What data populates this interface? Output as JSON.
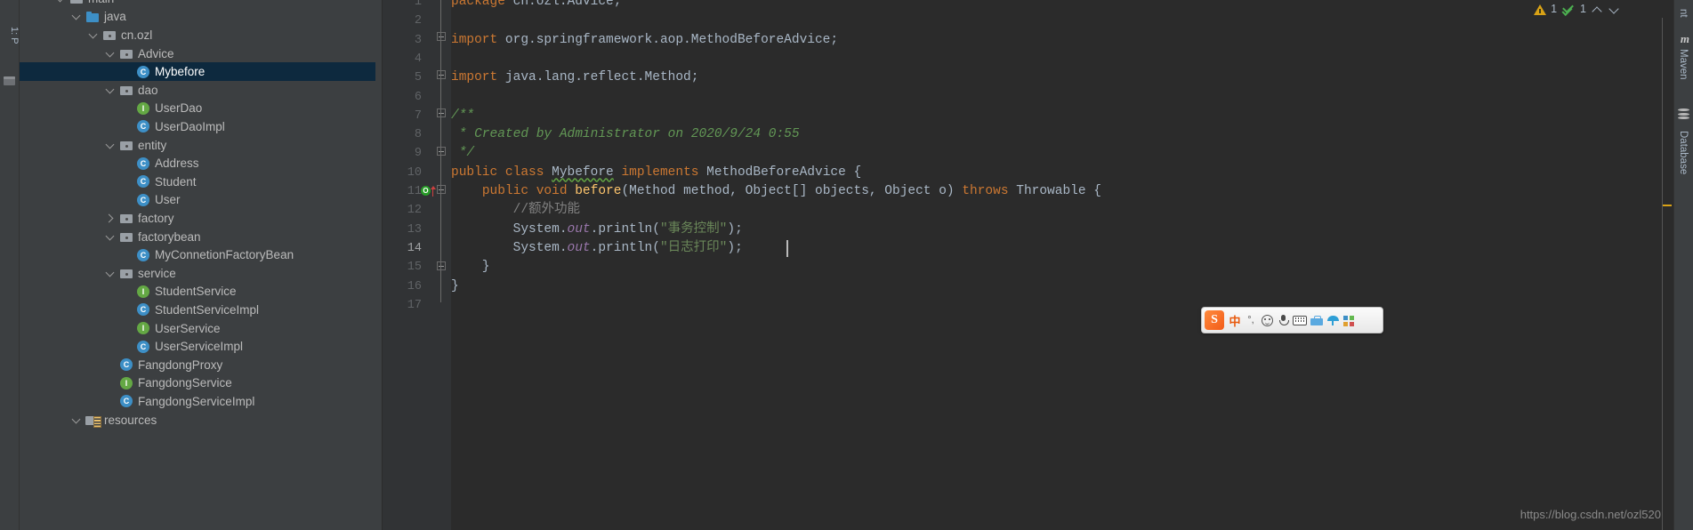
{
  "left_tool_strip": {
    "project_tab": "1: P",
    "structure_icon": "structure-icon"
  },
  "project_tree": {
    "rows": [
      {
        "label": "main",
        "indent": 40,
        "twisty": "open",
        "icon": "folder-plain",
        "selected": false
      },
      {
        "label": "java",
        "indent": 58,
        "twisty": "open",
        "icon": "folder-src",
        "selected": false
      },
      {
        "label": "cn.ozl",
        "indent": 77,
        "twisty": "open",
        "icon": "folder-pkg",
        "selected": false
      },
      {
        "label": "Advice",
        "indent": 96,
        "twisty": "open",
        "icon": "folder-pkg",
        "selected": false
      },
      {
        "label": "Mybefore",
        "indent": 115,
        "twisty": "none",
        "icon": "cls",
        "selected": true
      },
      {
        "label": "dao",
        "indent": 96,
        "twisty": "open",
        "icon": "folder-pkg",
        "selected": false
      },
      {
        "label": "UserDao",
        "indent": 115,
        "twisty": "none",
        "icon": "iface",
        "selected": false
      },
      {
        "label": "UserDaoImpl",
        "indent": 115,
        "twisty": "none",
        "icon": "cls",
        "selected": false
      },
      {
        "label": "entity",
        "indent": 96,
        "twisty": "open",
        "icon": "folder-pkg",
        "selected": false
      },
      {
        "label": "Address",
        "indent": 115,
        "twisty": "none",
        "icon": "cls",
        "selected": false
      },
      {
        "label": "Student",
        "indent": 115,
        "twisty": "none",
        "icon": "cls",
        "selected": false
      },
      {
        "label": "User",
        "indent": 115,
        "twisty": "none",
        "icon": "cls",
        "selected": false
      },
      {
        "label": "factory",
        "indent": 96,
        "twisty": "closed",
        "icon": "folder-pkg",
        "selected": false
      },
      {
        "label": "factorybean",
        "indent": 96,
        "twisty": "open",
        "icon": "folder-pkg",
        "selected": false
      },
      {
        "label": "MyConnetionFactoryBean",
        "indent": 115,
        "twisty": "none",
        "icon": "cls",
        "selected": false
      },
      {
        "label": "service",
        "indent": 96,
        "twisty": "open",
        "icon": "folder-pkg",
        "selected": false
      },
      {
        "label": "StudentService",
        "indent": 115,
        "twisty": "none",
        "icon": "iface",
        "selected": false
      },
      {
        "label": "StudentServiceImpl",
        "indent": 115,
        "twisty": "none",
        "icon": "cls",
        "selected": false
      },
      {
        "label": "UserService",
        "indent": 115,
        "twisty": "none",
        "icon": "iface",
        "selected": false
      },
      {
        "label": "UserServiceImpl",
        "indent": 115,
        "twisty": "none",
        "icon": "cls",
        "selected": false
      },
      {
        "label": "FangdongProxy",
        "indent": 96,
        "twisty": "none",
        "icon": "cls",
        "selected": false
      },
      {
        "label": "FangdongService",
        "indent": 96,
        "twisty": "none",
        "icon": "iface",
        "selected": false
      },
      {
        "label": "FangdongServiceImpl",
        "indent": 96,
        "twisty": "none",
        "icon": "cls",
        "selected": false
      },
      {
        "label": "resources",
        "indent": 58,
        "twisty": "open",
        "icon": "folder-res",
        "selected": false
      }
    ]
  },
  "editor": {
    "line_numbers": [
      "1",
      "2",
      "3",
      "4",
      "5",
      "6",
      "7",
      "8",
      "9",
      "10",
      "11",
      "12",
      "13",
      "14",
      "15",
      "16",
      "17"
    ],
    "current_line": "14",
    "lines": [
      {
        "n": "1",
        "tokens": [
          {
            "t": "package ",
            "c": "kw"
          },
          {
            "t": "cn.ozl.Advice;",
            "c": "txt"
          }
        ]
      },
      {
        "n": "2",
        "tokens": []
      },
      {
        "n": "3",
        "tokens": [
          {
            "t": "import ",
            "c": "kw"
          },
          {
            "t": "org.springframework.aop.MethodBeforeAdvice;",
            "c": "txt"
          }
        ]
      },
      {
        "n": "4",
        "tokens": []
      },
      {
        "n": "5",
        "tokens": [
          {
            "t": "import ",
            "c": "kw"
          },
          {
            "t": "java.lang.reflect.Method;",
            "c": "txt"
          }
        ]
      },
      {
        "n": "6",
        "tokens": []
      },
      {
        "n": "7",
        "tokens": [
          {
            "t": "/**",
            "c": "doc"
          }
        ]
      },
      {
        "n": "8",
        "tokens": [
          {
            "t": " * Created by Administrator on 2020/9/24 0:55",
            "c": "doc"
          }
        ]
      },
      {
        "n": "9",
        "tokens": [
          {
            "t": " */",
            "c": "doc"
          }
        ]
      },
      {
        "n": "10",
        "tokens": [
          {
            "t": "public class ",
            "c": "kw"
          },
          {
            "t": "Mybefore",
            "c": "txt wavy"
          },
          {
            "t": " ",
            "c": "txt"
          },
          {
            "t": "implements",
            "c": "kw"
          },
          {
            "t": " MethodBeforeAdvice {",
            "c": "txt"
          }
        ]
      },
      {
        "n": "11",
        "tokens": [
          {
            "t": "    ",
            "c": "txt"
          },
          {
            "t": "public void ",
            "c": "kw"
          },
          {
            "t": "before",
            "c": "fn"
          },
          {
            "t": "(Method method, Object[] objects, Object o) ",
            "c": "txt"
          },
          {
            "t": "throws",
            "c": "kw"
          },
          {
            "t": " Throwable {",
            "c": "txt"
          }
        ]
      },
      {
        "n": "12",
        "tokens": [
          {
            "t": "        //额外功能",
            "c": "cmt"
          }
        ]
      },
      {
        "n": "13",
        "tokens": [
          {
            "t": "        System.",
            "c": "txt"
          },
          {
            "t": "out",
            "c": "fld"
          },
          {
            "t": ".println(",
            "c": "txt"
          },
          {
            "t": "\"事务控制\"",
            "c": "str"
          },
          {
            "t": ");",
            "c": "txt"
          }
        ]
      },
      {
        "n": "14",
        "tokens": [
          {
            "t": "        System.",
            "c": "txt"
          },
          {
            "t": "out",
            "c": "fld"
          },
          {
            "t": ".println(",
            "c": "txt"
          },
          {
            "t": "\"日志打印\"",
            "c": "str"
          },
          {
            "t": ");",
            "c": "txt"
          }
        ]
      },
      {
        "n": "15",
        "tokens": [
          {
            "t": "    }",
            "c": "txt"
          }
        ]
      },
      {
        "n": "16",
        "tokens": [
          {
            "t": "}",
            "c": "txt"
          }
        ]
      },
      {
        "n": "17",
        "tokens": []
      }
    ],
    "gutter_markers": [
      {
        "line": "11",
        "type": "overriding-method-marker",
        "glyph": "O"
      }
    ]
  },
  "inspection_widget": {
    "warning_icon": "warning-triangle-icon",
    "warning_count": "1",
    "ok_icon": "inspection-ok-check-icon",
    "ok_count": "1",
    "prev_icon": "chevron-up-icon",
    "next_icon": "chevron-down-icon"
  },
  "right_tool_strip": {
    "tabs": [
      {
        "label": "nt",
        "name": "tool-window-ant"
      },
      {
        "label": "Maven",
        "name": "tool-window-maven"
      },
      {
        "label": "Database",
        "name": "tool-window-database"
      }
    ]
  },
  "ime_toolbar": {
    "logo": "S",
    "mode_label": "中",
    "items": [
      {
        "name": "halfwidth-fullwidth-icon",
        "glyph": "°,"
      },
      {
        "name": "emoji-icon",
        "glyph": ""
      },
      {
        "name": "voice-input-icon",
        "glyph": ""
      },
      {
        "name": "soft-keyboard-icon",
        "glyph": ""
      },
      {
        "name": "toolbox-icon",
        "glyph": ""
      },
      {
        "name": "skin-icon",
        "glyph": ""
      },
      {
        "name": "app-grid-icon",
        "glyph": ""
      }
    ]
  },
  "watermark": {
    "text": "https://blog.csdn.net/ozl520"
  },
  "colors": {
    "editor_bg": "#2b2b2b",
    "panel_bg": "#3c3f41",
    "gutter_bg": "#313335",
    "selection": "#0d293e",
    "keyword": "#cc7832",
    "string": "#6a8759",
    "javadoc": "#629755",
    "comment": "#808080",
    "method": "#ffc66d",
    "field": "#9876aa",
    "text": "#a9b7c6",
    "warning": "#d9a216",
    "ok": "#4caf50"
  }
}
